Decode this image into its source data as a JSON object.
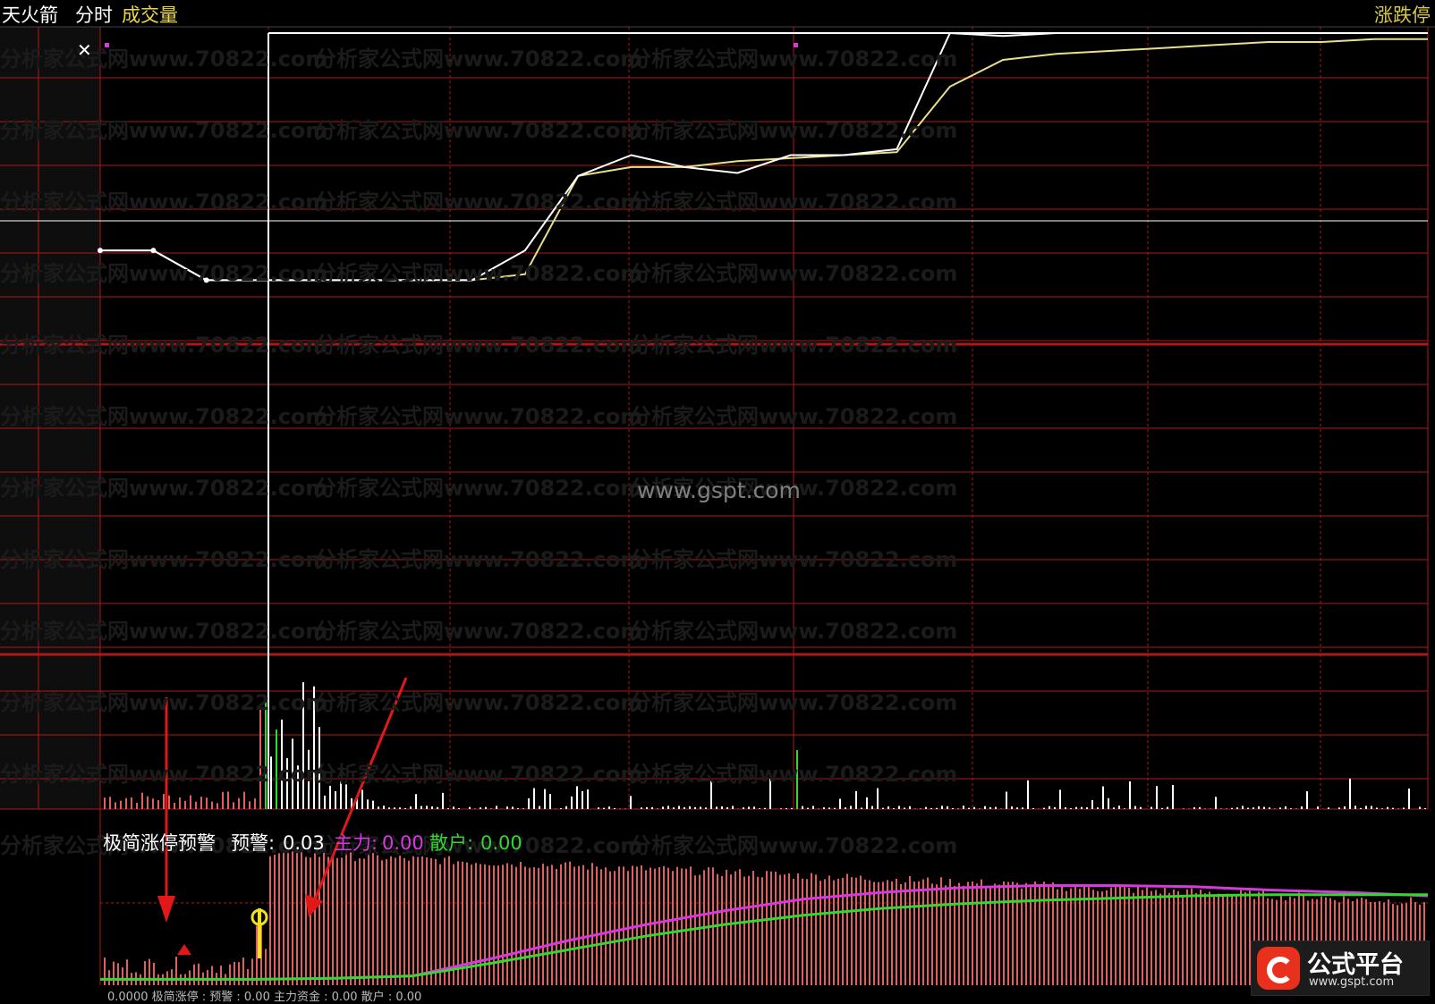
{
  "header": {
    "app_name": "天火箭",
    "mode": "分时",
    "volume_label": "成交量",
    "limit_label": "涨跌停"
  },
  "indicator": {
    "name": "极简涨停预警",
    "warn_label": "预警:",
    "warn_value": "0.03",
    "main_label": "主力:",
    "main_value": "0.00",
    "retail_label": "散户:",
    "retail_value": "0.00",
    "truncated_text": "0.0000 极简涨停 : 预警 : 0.00  主力资金 : 0.00  散户 : 0.00"
  },
  "watermark": {
    "tile": "分析家公式网www.70822.com",
    "center": "www.gspt.com"
  },
  "logo": {
    "name": "公式平台",
    "url": "www.gspt.com"
  },
  "colors": {
    "grid": "#b01818",
    "price_line": "#ffffff",
    "avg_line": "#e8e08a",
    "main_line": "#d838e0",
    "retail_line": "#30d830",
    "bars": "#e06060",
    "header_yellow": "#e8d848",
    "arrow": "#e01818"
  },
  "chart_data": {
    "type": "line",
    "title": "",
    "notes": "intraday time-share chart with volume and indicator sub-panels; no axis tick labels visible",
    "price_series": [
      {
        "name": "price",
        "values": [
          0.3,
          0.3,
          0.2,
          0.2,
          0.2,
          0.2,
          0.2,
          0.2,
          0.3,
          0.55,
          0.62,
          0.58,
          0.56,
          0.62,
          0.62,
          0.64,
          1.05,
          1.02,
          1.03,
          1.03,
          1.03,
          1.03,
          1.03,
          1.03,
          1.03,
          1.03
        ]
      },
      {
        "name": "average",
        "values": [
          0.3,
          0.3,
          0.2,
          0.2,
          0.2,
          0.2,
          0.2,
          0.2,
          0.22,
          0.55,
          0.58,
          0.58,
          0.6,
          0.61,
          0.62,
          0.63,
          0.85,
          0.94,
          0.96,
          0.97,
          0.98,
          0.99,
          1.0,
          1.0,
          1.01,
          1.01
        ]
      }
    ],
    "indicator_series": [
      {
        "name": "主力",
        "values": [
          0.02,
          0.02,
          0.02,
          0.03,
          0.05,
          0.2,
          0.36,
          0.5,
          0.62,
          0.72,
          0.78,
          0.82,
          0.84,
          0.84,
          0.83,
          0.8,
          0.78,
          0.75
        ]
      },
      {
        "name": "散户",
        "values": [
          0.02,
          0.02,
          0.02,
          0.03,
          0.05,
          0.16,
          0.28,
          0.4,
          0.5,
          0.58,
          0.64,
          0.68,
          0.71,
          0.73,
          0.75,
          0.76,
          0.76,
          0.76
        ]
      }
    ],
    "markers": [
      {
        "type": "arrow",
        "direction": "down",
        "target": "indicator red triangle"
      },
      {
        "type": "arrow",
        "direction": "down-left",
        "target": "indicator yellow signal"
      }
    ]
  }
}
